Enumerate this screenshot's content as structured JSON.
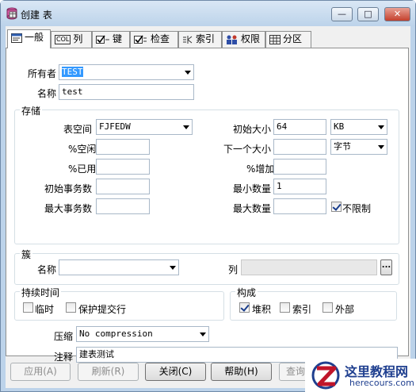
{
  "window": {
    "title": "创建 表",
    "controls": {
      "minimize": "—",
      "maximize": "□",
      "close": "✕"
    }
  },
  "tabs": [
    {
      "label": "一般",
      "icon": "general-tab-icon",
      "active": true
    },
    {
      "label": "列",
      "icon": "col-icon",
      "icon_text": "COL"
    },
    {
      "label": "键",
      "icon": "key-icon"
    },
    {
      "label": "检查",
      "icon": "check-icon"
    },
    {
      "label": "索引",
      "icon": "index-icon"
    },
    {
      "label": "权限",
      "icon": "users-icon"
    },
    {
      "label": "分区",
      "icon": "grid-icon"
    }
  ],
  "general": {
    "owner_label": "所有者",
    "owner_value": "TEST",
    "name_label": "名称",
    "name_value": "test"
  },
  "storage": {
    "title": "存储",
    "tablespace_label": "表空间",
    "tablespace_value": "FJFEDW",
    "pct_free_label": "%空闲",
    "pct_free_value": "",
    "pct_used_label": "%已用",
    "pct_used_value": "",
    "ini_trans_label": "初始事务数",
    "ini_trans_value": "",
    "max_trans_label": "最大事务数",
    "max_trans_value": "",
    "initial_label": "初始大小",
    "initial_value": "64",
    "initial_unit": "KB",
    "next_label": "下一个大小",
    "next_value": "",
    "next_unit": "字节",
    "pct_increase_label": "%增加",
    "pct_increase_value": "",
    "min_extents_label": "最小数量",
    "min_extents_value": "1",
    "max_extents_label": "最大数量",
    "max_extents_value": "",
    "unlimited_label": "不限制",
    "unlimited_checked": true
  },
  "cluster": {
    "title": "簇",
    "name_label": "名称",
    "name_value": "",
    "columns_label": "列",
    "columns_value": "",
    "browse_label": "..."
  },
  "duration": {
    "title": "持续时间",
    "temporary_label": "临时",
    "temporary_checked": false,
    "preserve_label": "保护提交行",
    "preserve_checked": false
  },
  "organization": {
    "title": "构成",
    "heap_label": "堆积",
    "heap_checked": true,
    "index_label": "索引",
    "index_checked": false,
    "external_label": "外部",
    "external_checked": false
  },
  "compression": {
    "label": "压缩",
    "value": "No compression"
  },
  "comment": {
    "label": "注释",
    "value": "建表测试"
  },
  "buttons": {
    "apply": "应用(A)",
    "refresh": "刷新(R)",
    "close": "关闭(C)",
    "help": "帮助(H)",
    "query": "查询"
  },
  "watermark": {
    "text": "这里教程网",
    "url": "herecours.com"
  },
  "colors": {
    "frame": "#bcd3ea",
    "selection": "#3399ff",
    "watermark_red": "#c0152a",
    "watermark_blue": "#1f3f8f"
  }
}
